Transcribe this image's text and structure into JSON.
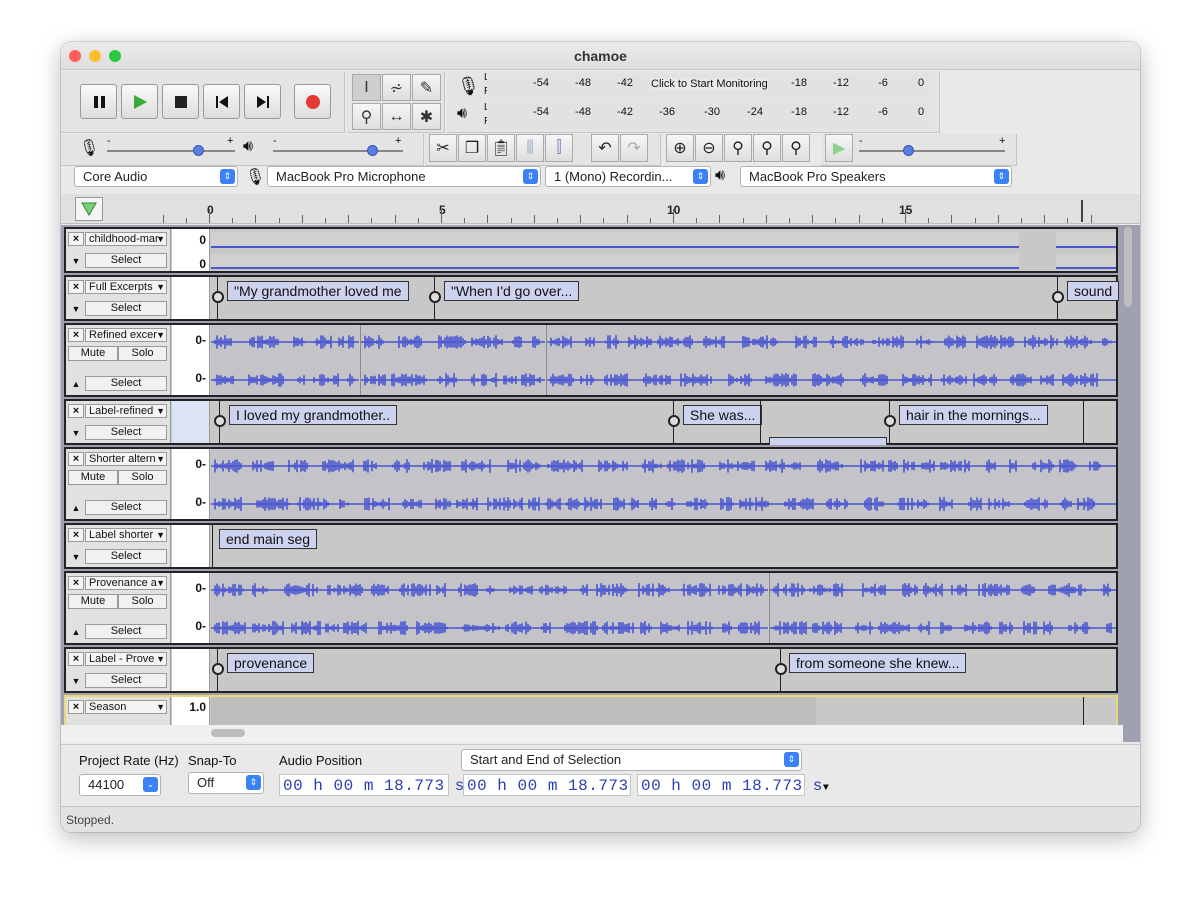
{
  "window": {
    "title": "chamoe"
  },
  "transport": {
    "pause": "Pause",
    "play": "Play",
    "stop": "Stop",
    "skip_start": "Skip to Start",
    "skip_end": "Skip to End",
    "record": "Record"
  },
  "meter": {
    "rec_labels": [
      "-54",
      "-48",
      "-42",
      "Click to Start Monitoring",
      "-18",
      "-12",
      "-6",
      "0"
    ],
    "play_labels": [
      "-54",
      "-48",
      "-42",
      "-36",
      "-30",
      "-24",
      "-18",
      "-12",
      "-6",
      "0"
    ],
    "L": "L",
    "R": "R"
  },
  "mixer": {
    "minus": "-",
    "plus": "+"
  },
  "devices": {
    "host": "Core Audio",
    "input": "MacBook Pro Microphone",
    "channels": "1 (Mono) Recordin...",
    "output": "MacBook Pro Speakers"
  },
  "ruler": {
    "marks": [
      "0",
      "5",
      "10",
      "15"
    ]
  },
  "tracks": [
    {
      "name": "childhood-mar",
      "zero_top": "0",
      "zero_bottom": "0",
      "select": "Select"
    },
    {
      "name": "Full Excerpts",
      "select": "Select",
      "labels": [
        "\"My grandmother loved me",
        "\"When I'd go over...",
        "sound"
      ]
    },
    {
      "name": "Refined excer",
      "mute": "Mute",
      "solo": "Solo",
      "select": "Select",
      "zero_top": "0-",
      "zero_bottom": "0-"
    },
    {
      "name": "Label-refined",
      "select": "Select",
      "labels": [
        "I loved my grandmother..",
        "She was...",
        "hair in the mornings..."
      ]
    },
    {
      "name": "Shorter altern",
      "mute": "Mute",
      "solo": "Solo",
      "select": "Select",
      "zero_top": "0-",
      "zero_bottom": "0-"
    },
    {
      "name": "Label shorter",
      "select": "Select",
      "labels": [
        "end main seg"
      ]
    },
    {
      "name": "Provenance a",
      "mute": "Mute",
      "solo": "Solo",
      "select": "Select",
      "zero_top": "0-",
      "zero_bottom": "0-"
    },
    {
      "name": "Label - Prove",
      "select": "Select",
      "labels": [
        "provenance",
        "from someone she knew..."
      ]
    },
    {
      "name": "Season",
      "value": "1.0"
    }
  ],
  "bottom": {
    "rate_label": "Project Rate (Hz)",
    "rate_value": "44100",
    "snap_label": "Snap-To",
    "snap_value": "Off",
    "audio_pos_label": "Audio Position",
    "selection_mode": "Start and End of Selection",
    "audio_pos": "00 h 00 m 18.773 s",
    "sel_start": "00 h 00 m 18.773 s",
    "sel_end": "00 h 00 m 18.773 s"
  },
  "status": {
    "text": "Stopped."
  },
  "colors": {
    "wave": "#4a55d0",
    "label_bg": "#cdd2ee",
    "record": "#e53935",
    "play": "#3aa83a",
    "accent": "#3b82f6"
  }
}
